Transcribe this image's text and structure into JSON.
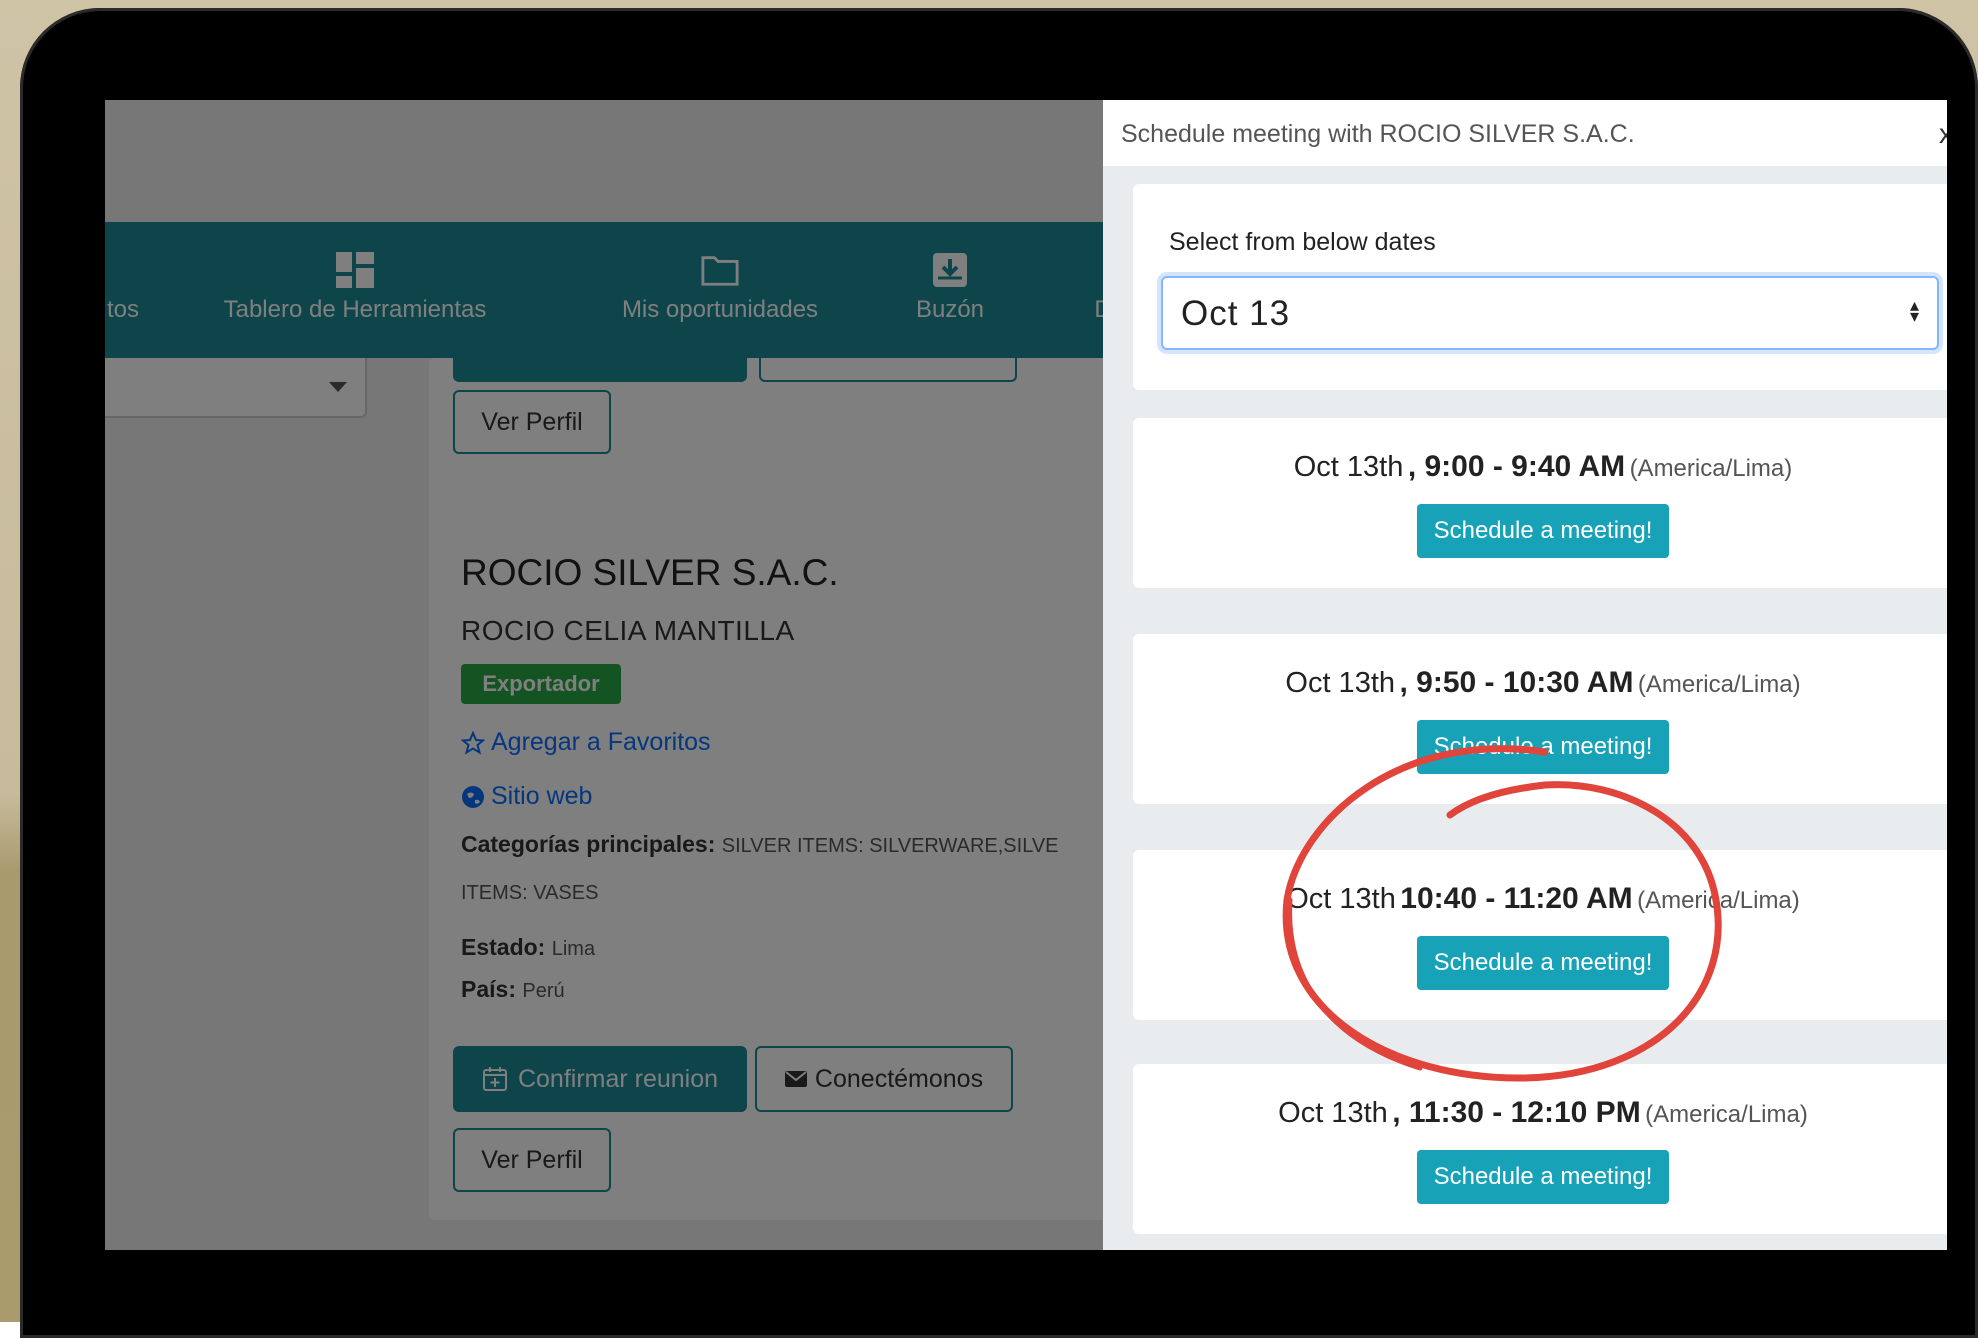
{
  "nav": {
    "items": [
      {
        "label": "tos"
      },
      {
        "label": "Tablero de Herramientas"
      },
      {
        "label": "Mis oportunidades"
      },
      {
        "label": "Buzón"
      },
      {
        "label": "D"
      }
    ]
  },
  "card_top": {
    "view_profile_label": "Ver Perfil"
  },
  "card_main": {
    "company": "ROCIO SILVER S.A.C.",
    "contact": "ROCIO CELIA MANTILLA",
    "badge": "Exportador",
    "favorite_label": "Agregar a Favoritos",
    "website_label": "Sitio web",
    "categories_label": "Categorías principales:",
    "categories_value": "SILVER ITEMS: SILVERWARE,SILVE",
    "categories_value2": "ITEMS: VASES",
    "state_label": "Estado:",
    "state_value": "Lima",
    "country_label": "País:",
    "country_value": "Perú",
    "confirm_label": "Confirmar reunion",
    "connect_label": "Conectémonos",
    "view_profile_label": "Ver Perfil"
  },
  "panel": {
    "title": "Schedule meeting with ROCIO SILVER S.A.C.",
    "close": "x",
    "date_label": "Select from below dates",
    "date_value": "Oct  13",
    "slots": [
      {
        "date": "Oct 13th",
        "time": ", 9:00 - 9:40 AM",
        "tz": "(America/Lima)",
        "button": "Schedule a meeting!"
      },
      {
        "date": "Oct 13th",
        "time": ", 9:50 - 10:30 AM",
        "tz": "(America/Lima)",
        "button": "Schedule a meeting!"
      },
      {
        "date": "Oct 13th",
        "time": "10:40 - 11:20 AM",
        "tz": "(America/Lima)",
        "button": "Schedule a meeting!"
      },
      {
        "date": "Oct 13th",
        "time": ", 11:30 - 12:10 PM",
        "tz": "(America/Lima)",
        "button": "Schedule a meeting!"
      }
    ]
  },
  "colors": {
    "teal": "#1a8a96",
    "button": "#17a2b8",
    "badge": "#28a745",
    "annotation": "#e0443a"
  }
}
